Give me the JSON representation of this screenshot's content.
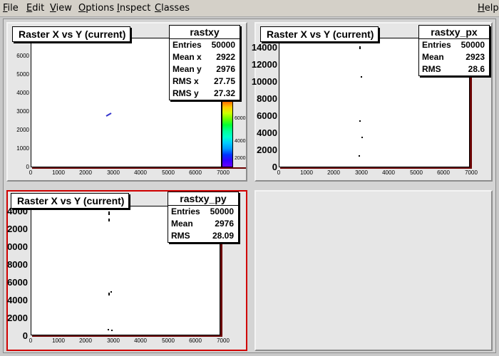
{
  "menubar": {
    "items": [
      {
        "label": "File",
        "name": "menu-file"
      },
      {
        "label": "Edit",
        "name": "menu-edit"
      },
      {
        "label": "View",
        "name": "menu-view"
      },
      {
        "label": "Options",
        "name": "menu-options"
      },
      {
        "label": "Inspect",
        "name": "menu-inspect"
      },
      {
        "label": "Classes",
        "name": "menu-classes"
      }
    ],
    "help": "Help"
  },
  "pads": [
    {
      "title": "Raster X vs Y (current)",
      "stats": {
        "name": "rastxy",
        "rows": [
          {
            "k": "Entries",
            "v": "50000"
          },
          {
            "k": "Mean x",
            "v": "2922"
          },
          {
            "k": "Mean y",
            "v": "2976"
          },
          {
            "k": "RMS x",
            "v": "27.75"
          },
          {
            "k": "RMS y",
            "v": "27.32"
          }
        ]
      },
      "yticks": [
        "6000",
        "5000",
        "4000",
        "3000",
        "2000",
        "1000",
        "0"
      ],
      "xticks": [
        "0",
        "1000",
        "2000",
        "3000",
        "4000",
        "5000",
        "6000",
        "7000"
      ],
      "palette_ticks": [
        "6000",
        "4000",
        "2000"
      ],
      "palette_colors": [
        "#ff0000",
        "#ff6600",
        "#ffcc00",
        "#ccff00",
        "#66ff00",
        "#00ff33",
        "#00ff99",
        "#00ffcc",
        "#00ccff",
        "#0099ff",
        "#0033ff",
        "#3300ff",
        "#6600ff"
      ]
    },
    {
      "title": "Raster X vs Y (current)",
      "stats": {
        "name": "rastxy_px",
        "rows": [
          {
            "k": "Entries",
            "v": "50000"
          },
          {
            "k": "Mean",
            "v": "2923"
          },
          {
            "k": "RMS",
            "v": "28.6"
          }
        ]
      },
      "yticks": [
        "14000",
        "12000",
        "10000",
        "8000",
        "6000",
        "4000",
        "2000",
        "0"
      ],
      "xticks": [
        "0",
        "1000",
        "2000",
        "3000",
        "4000",
        "5000",
        "6000",
        "7000"
      ]
    },
    {
      "title": "Raster X vs Y (current)",
      "stats": {
        "name": "rastxy_py",
        "rows": [
          {
            "k": "Entries",
            "v": "50000"
          },
          {
            "k": "Mean",
            "v": "2976"
          },
          {
            "k": "RMS",
            "v": "28.09"
          }
        ]
      },
      "yticks": [
        "4000",
        "2000",
        "0000",
        "8000",
        "6000",
        "4000",
        "2000",
        "0"
      ],
      "xticks": [
        "0",
        "1000",
        "2000",
        "3000",
        "4000",
        "5000",
        "6000",
        "7000"
      ]
    }
  ],
  "colors": {
    "frame_shadow": "#6b0000",
    "active_pad_border": "#d00000",
    "marker": "#000000",
    "scatter_marker": "#3333cc"
  }
}
